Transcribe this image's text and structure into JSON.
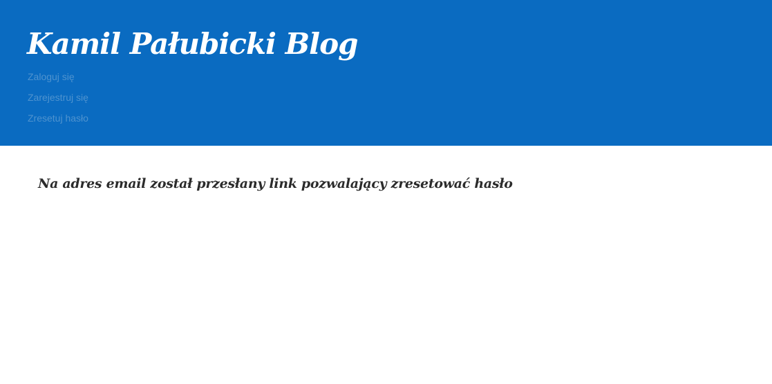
{
  "header": {
    "site_title": "Kamil Pałubicki Blog",
    "nav": [
      {
        "label": "Zaloguj się"
      },
      {
        "label": "Zarejestruj się"
      },
      {
        "label": "Zresetuj hasło"
      }
    ]
  },
  "main": {
    "message": "Na adres email został przesłany link pozwalający zresetować hasło"
  },
  "colors": {
    "header_background": "#0a6bc1",
    "title_text": "#ffffff",
    "nav_link": "#4f93cf",
    "message_text": "#2b2b2b",
    "page_background": "#ffffff"
  }
}
